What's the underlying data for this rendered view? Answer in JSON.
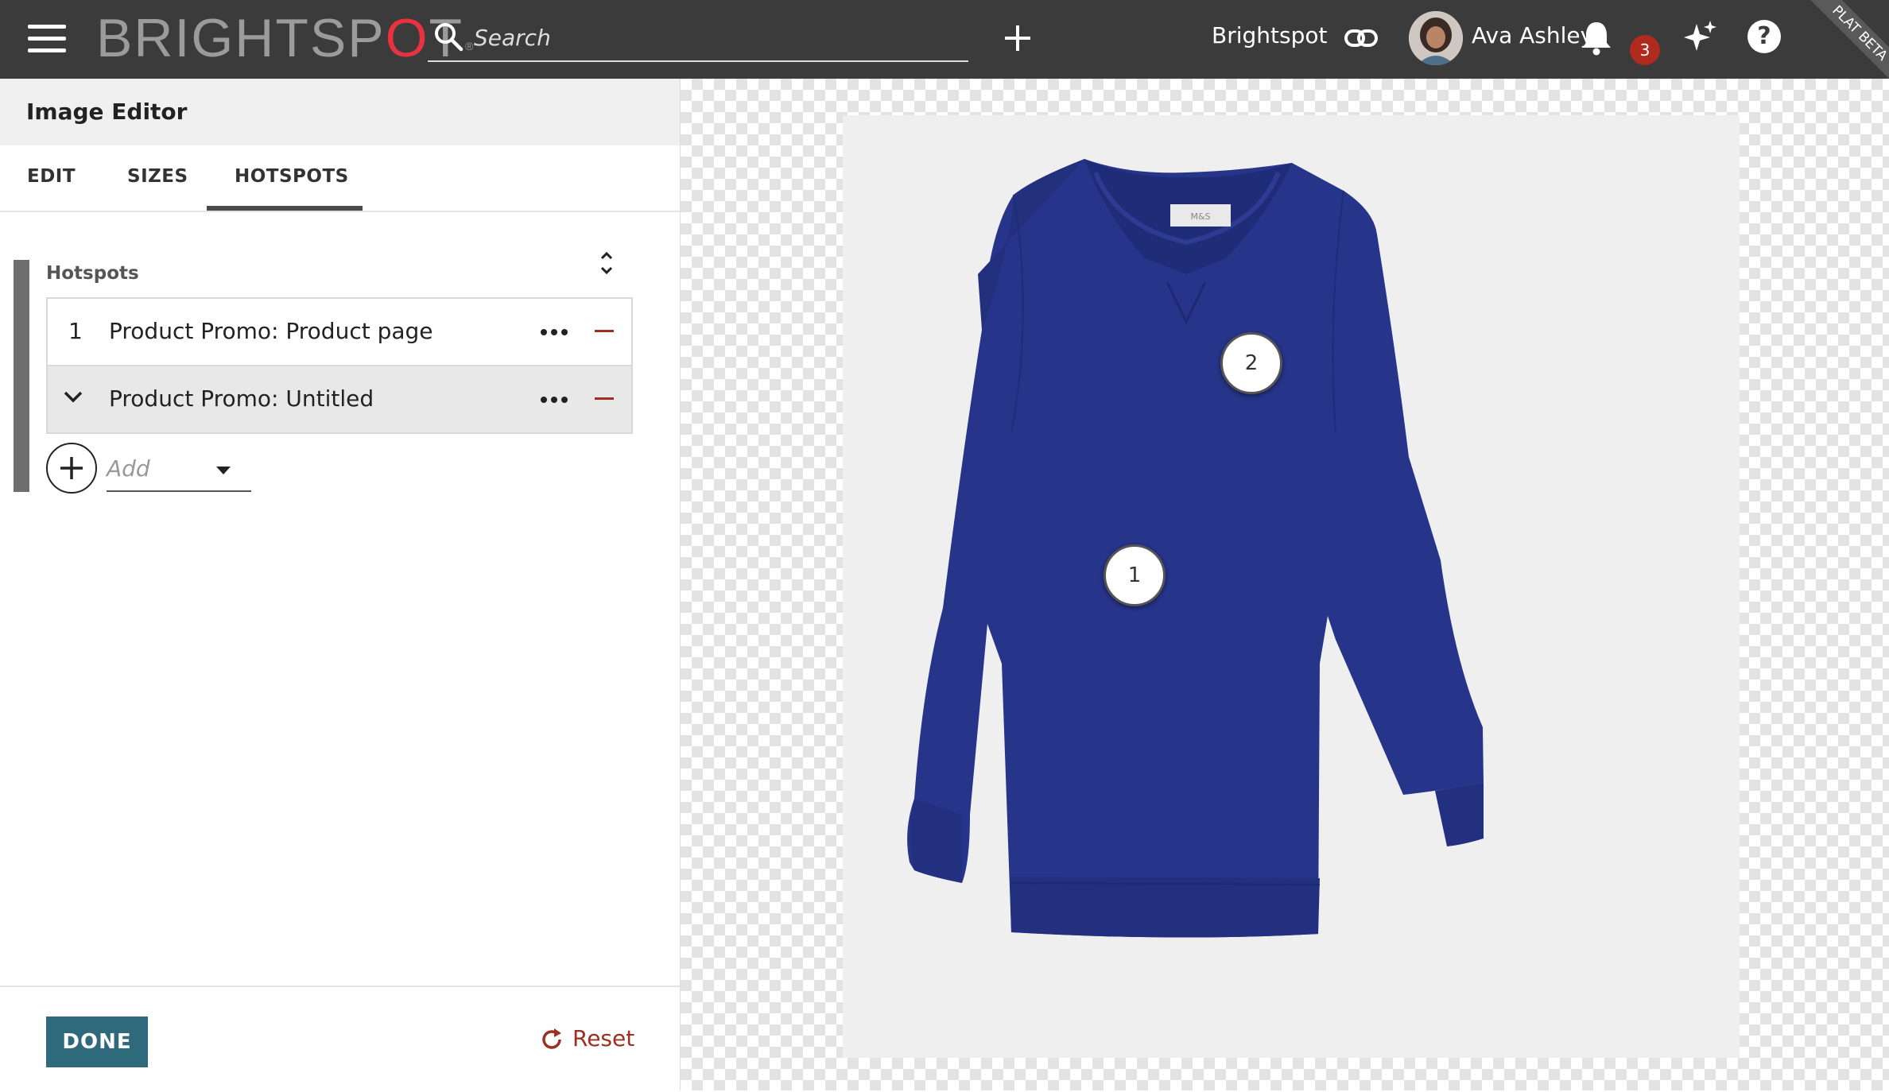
{
  "topbar": {
    "logo": {
      "main": "BRIGHTSP",
      "accent": "O",
      "tail": "T",
      "reg": "®"
    },
    "search_placeholder": "Search",
    "site_name": "Brightspot",
    "user_name": "Ava Ashley",
    "notification_count": "3",
    "help_label": "?",
    "ribbon": "PLAT BETA",
    "accent_color": "#e8323f"
  },
  "editor": {
    "title": "Image Editor",
    "tabs": [
      {
        "label": "EDIT"
      },
      {
        "label": "SIZES"
      },
      {
        "label": "HOTSPOTS",
        "active": true
      }
    ],
    "hotspots_label": "Hotspots",
    "hotspots": [
      {
        "index": "1",
        "label": "Product Promo: Product page"
      },
      {
        "label": "Product Promo: Untitled",
        "expanded": true
      }
    ],
    "add_placeholder": "Add",
    "done_label": "DONE",
    "reset_label": "Reset",
    "done_color": "#2f6a7c",
    "danger_color": "#9c2f22"
  },
  "canvas": {
    "label_tag": "M&S",
    "markers": [
      {
        "label": "1"
      },
      {
        "label": "2"
      }
    ]
  }
}
